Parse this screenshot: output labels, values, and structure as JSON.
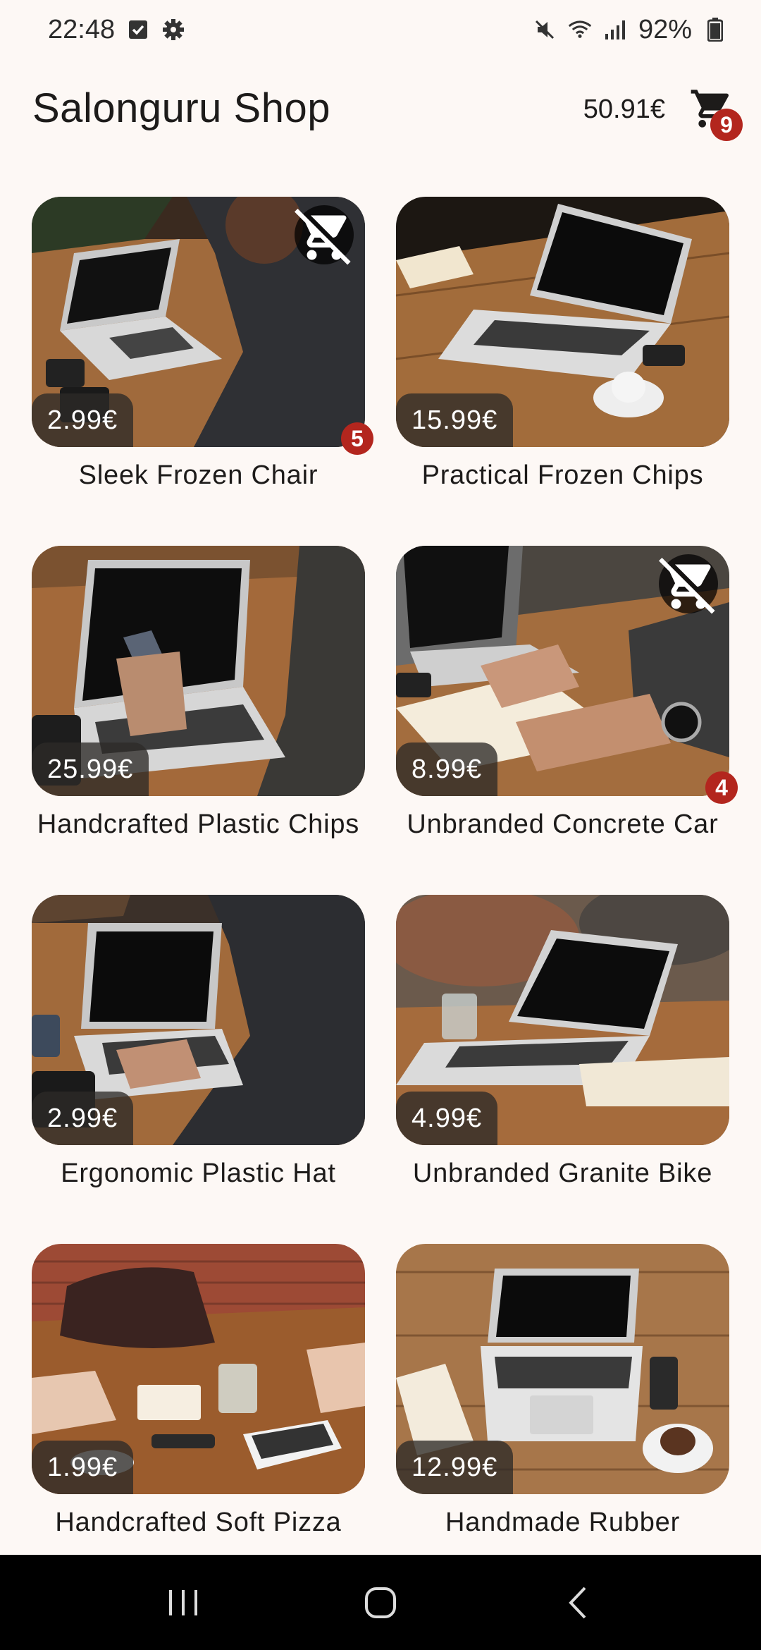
{
  "status": {
    "time": "22:48",
    "battery": "92%"
  },
  "app": {
    "title": "Salonguru Shop",
    "cart_total": "50.91€",
    "cart_count": "9"
  },
  "products": [
    {
      "name": "Sleek Frozen Chair",
      "price": "2.99€",
      "in_cart": true,
      "qty": "5"
    },
    {
      "name": "Practical Frozen Chips",
      "price": "15.99€",
      "in_cart": false,
      "qty": ""
    },
    {
      "name": "Handcrafted Plastic Chips",
      "price": "25.99€",
      "in_cart": false,
      "qty": ""
    },
    {
      "name": "Unbranded Concrete Car",
      "price": "8.99€",
      "in_cart": true,
      "qty": "4"
    },
    {
      "name": "Ergonomic Plastic Hat",
      "price": "2.99€",
      "in_cart": false,
      "qty": ""
    },
    {
      "name": "Unbranded Granite Bike",
      "price": "4.99€",
      "in_cart": false,
      "qty": ""
    },
    {
      "name": "Handcrafted Soft Pizza",
      "price": "1.99€",
      "in_cart": false,
      "qty": ""
    },
    {
      "name": "Handmade Rubber",
      "price": "12.99€",
      "in_cart": false,
      "qty": ""
    }
  ],
  "colors": {
    "background": "#fdf8f5",
    "badge": "#b3261e",
    "wood": "#a06a3c"
  },
  "icons": {
    "cart": "shopping-cart-icon",
    "remove_cart": "remove-shopping-cart-icon"
  }
}
